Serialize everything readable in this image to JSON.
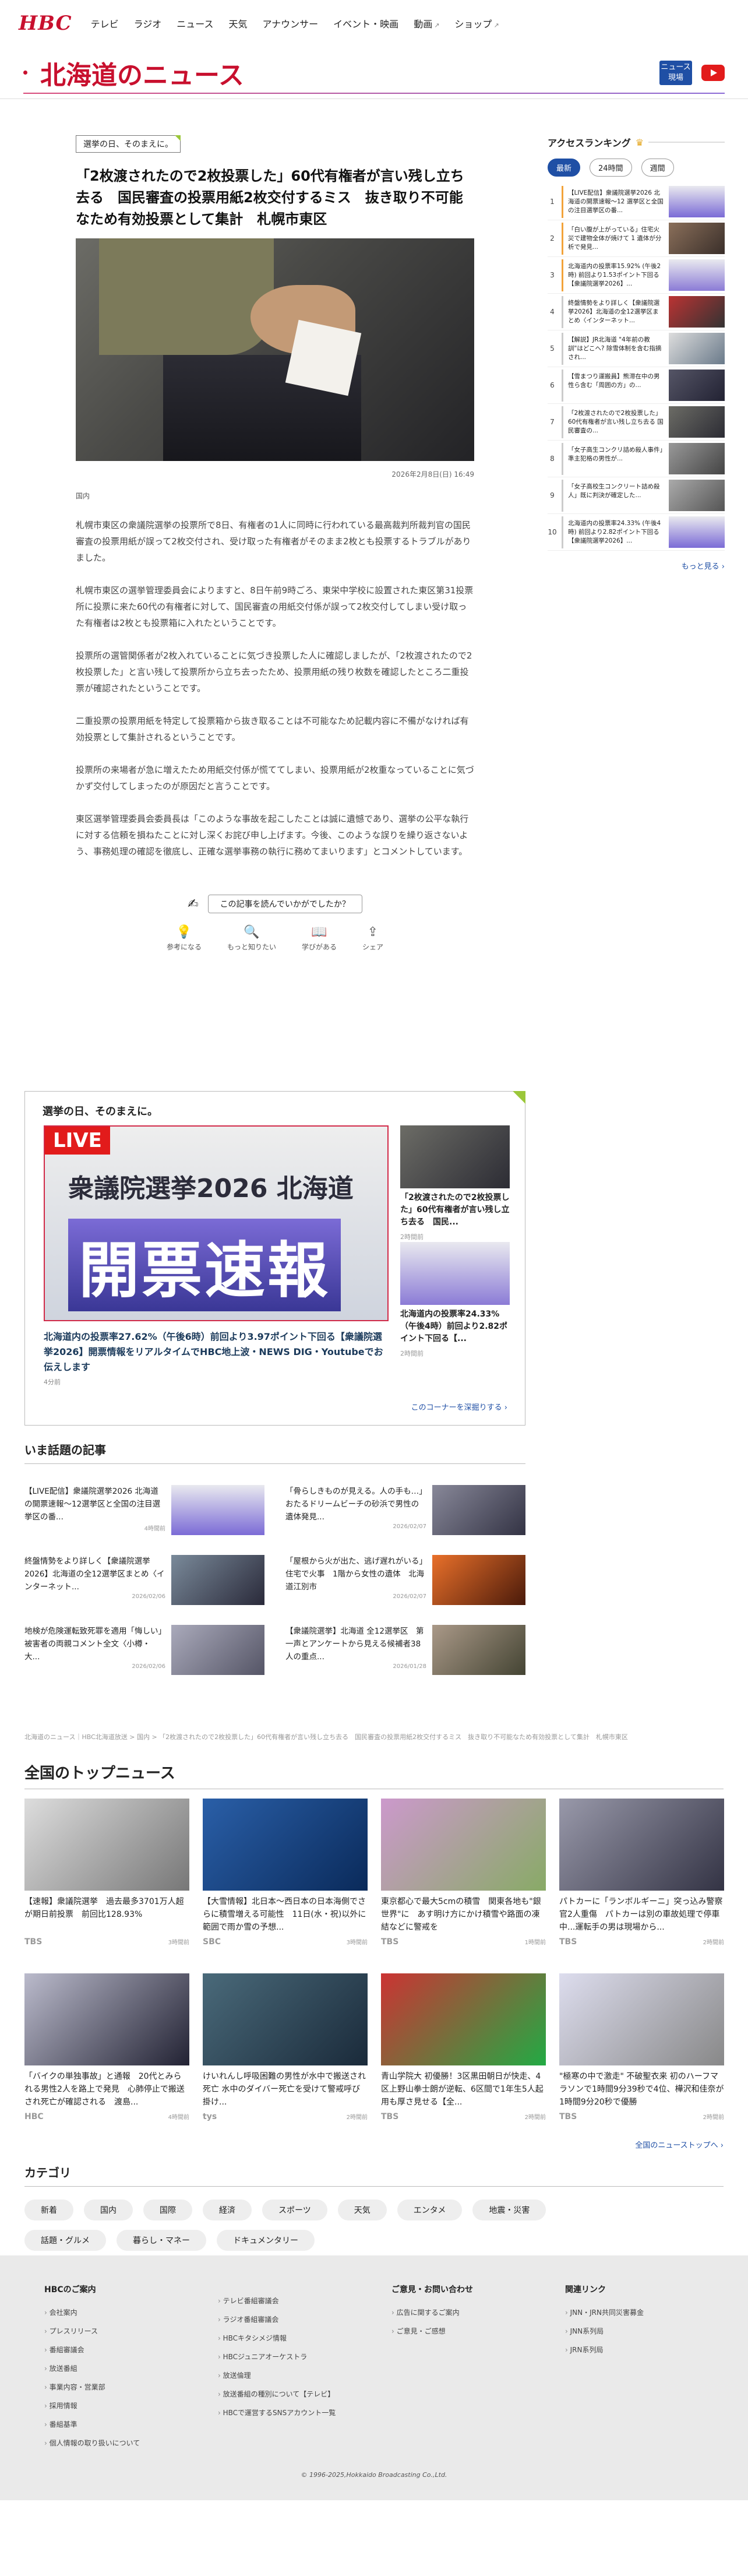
{
  "header": {
    "logo": "HBC",
    "nav": [
      "テレビ",
      "ラジオ",
      "ニュース",
      "天気",
      "アナウンサー",
      "イベント・映画",
      "動画",
      "ショップ"
    ],
    "page_title": "北海道のニュース",
    "newsnav_label": "ニュース 現場"
  },
  "article": {
    "tag": "選挙の日、そのまえに。",
    "headline": "「2枚渡されたので2枚投票した」60代有権者が言い残し立ち去る　国民審査の投票用紙2枚交付するミス　抜き取り不可能なため有効投票として集計　札幌市東区",
    "date": "2026年2月8日(日) 16:49",
    "category": "国内",
    "paragraphs": [
      "札幌市東区の衆議院選挙の投票所で8日、有権者の1人に同時に行われている最高裁判所裁判官の国民審査の投票用紙が誤って2枚交付され、受け取った有権者がそのまま2枚とも投票するトラブルがありました。",
      "札幌市東区の選挙管理委員会によりますと、8日午前9時ごろ、東栄中学校に設置された東区第31投票所に投票に来た60代の有権者に対して、国民審査の用紙交付係が誤って2枚交付してしまい受け取った有権者は2枚とも投票箱に入れたということです。",
      "投票所の選管関係者が2枚入れていることに気づき投票した人に確認しましたが、「2枚渡されたので2枚投票した」と言い残して投票所から立ち去ったため、投票用紙の残り枚数を確認したところ二重投票が確認されたということです。",
      "二重投票の投票用紙を特定して投票箱から抜き取ることは不可能なため記載内容に不備がなければ有効投票として集計されるということです。",
      "投票所の来場者が急に増えたため用紙交付係が慌ててしまい、投票用紙が2枚重なっていることに気づかず交付してしまったのが原因だと言うことです。",
      "東区選挙管理委員会委員長は「このような事故を起こしたことは誠に遺憾であり、選挙の公平な執行に対する信頼を損ねたことに対し深くお詫び申し上げます。今後、このような誤りを繰り返さないよう、事務処理の確認を徹底し、正確な選挙事務の執行に務めてまいります」とコメントしています。"
    ],
    "feedback_question": "この記事を読んでいかがでしたか？",
    "feedback_options": [
      "参考になる",
      "もっと知りたい",
      "学びがある",
      "シェア"
    ]
  },
  "ranking": {
    "title": "アクセスランキング",
    "tabs": [
      "最新",
      "24時間",
      "週間"
    ],
    "items": [
      {
        "rank": "1",
        "text": "【LIVE配信】衆議院選挙2026 北海道の開票速報〜12 選挙区と全国の注目選挙区の番..."
      },
      {
        "rank": "2",
        "text": "「白い腹が上がっている」住宅火災で建物全体が焼けて 1 遺体が分析で発見..."
      },
      {
        "rank": "3",
        "text": "北海道内の投票率15.92% (午後2時) 前回より1.53ポイント下回る【衆議院選挙2026】..."
      },
      {
        "rank": "4",
        "text": "終盤情勢をより詳しく【衆議院選挙2026】北海道の全12選挙区まとめ〈インターネット..."
      },
      {
        "rank": "5",
        "text": "【解説】JR北海道 \"4年前の教訓\"はどこへ? 除雪体制を含む指摘され..."
      },
      {
        "rank": "6",
        "text": "【雪まつり運搬員】熊滞在中の男性ら含む「周囲の方」の..."
      },
      {
        "rank": "7",
        "text": "「2枚渡されたので2枚投票した」60代有権者が言い残し立ち去る 国民審査の..."
      },
      {
        "rank": "8",
        "text": "「女子高生コンクリ詰め殺人事件」準主犯格の男性が..."
      },
      {
        "rank": "9",
        "text": "「女子高校生コンクリート詰め殺人」既に判決が確定した..."
      },
      {
        "rank": "10",
        "text": "北海道内の投票率24.33% (午後4時) 前回より2.82ポイント下回る【衆議院選挙2026】..."
      }
    ],
    "more": "もっと見る ›"
  },
  "series": {
    "title": "選挙の日、そのまえに。",
    "live": "LIVE",
    "banner_line1": "衆議院選挙2026 北海道",
    "banner_line2": "開票速報",
    "main_caption": "北海道内の投票率27.62%（午後6時）前回より3.97ポイント下回る【衆議院選挙2026】開票情報をリアルタイムでHBC地上波・NEWS DIG・Youtubeでお伝えします",
    "main_date": "4分前",
    "side": [
      {
        "caption": "「2枚渡されたので2枚投票した」60代有権者が言い残し立ち去る　国民...",
        "date": "2時間前"
      },
      {
        "caption": "北海道内の投票率24.33%（午後4時）前回より2.82ポイント下回る【...",
        "date": "2時間前"
      }
    ],
    "link": "このコーナーを深掘りする ›"
  },
  "trending": {
    "title": "いま話題の記事",
    "items": [
      {
        "text": "【LIVE配信】衆議院選挙2026 北海道の開票速報〜12選挙区と全国の注目選挙区の番...",
        "date": "4時間前"
      },
      {
        "text": "「骨らしきものが見える。人の手も…」おたるドリームビーチの砂浜で男性の遺体発見...",
        "date": "2026/02/07"
      },
      {
        "text": "終盤情勢をより詳しく【衆議院選挙2026】北海道の全12選挙区まとめ〈インターネット...",
        "date": "2026/02/06"
      },
      {
        "text": "「屋根から火が出た、逃げ遅れがいる」住宅で火事　1階から女性の遺体　北海道江別市",
        "date": "2026/02/07"
      },
      {
        "text": "地検が危険運転致死罪を適用「悔しい」被害者の両親コメント全文〈小樽・大...",
        "date": "2026/02/06"
      },
      {
        "text": "【衆議院選挙】北海道 全12選挙区　第一声とアンケートから見える候補者38人の重点...",
        "date": "2026/01/28"
      }
    ]
  },
  "breadcrumb": "北海道のニュース｜HBC北海道放送 > 国内 > 「2枚渡されたので2枚投票した」60代有権者が言い残し立ち去る　国民審査の投票用紙2枚交付するミス　抜き取り不可能なため有効投票として集計　札幌市東区",
  "topnews": {
    "title": "全国のトップニュース",
    "items": [
      {
        "text": "【速報】衆議院選挙　過去最多3701万人超が期日前投票　前回比128.93%",
        "station": "TBS",
        "date": "3時間前"
      },
      {
        "text": "【大雪情報】北日本〜西日本の日本海側でさらに積雪増える可能性　11日(水・祝)以外に範囲で雨か雪の予想...",
        "station": "SBC",
        "date": "3時間前"
      },
      {
        "text": "東京都心で最大5cmの積雪　関東各地も\"銀世界\"に　あす明け方にかけ積雪や路面の凍結などに警戒を",
        "station": "TBS",
        "date": "1時間前"
      },
      {
        "text": "パトカーに「ランボルギーニ」突っ込み警察官2人重傷　パトカーは別の車故処理で停車中...運転手の男は現場から...",
        "station": "TBS",
        "date": "2時間前"
      },
      {
        "text": "「バイクの単独事故」と通報　20代とみられる男性2人を路上で発見　心肺停止で搬送され死亡が確認される　渡島...",
        "station": "HBC",
        "date": "4時間前"
      },
      {
        "text": "けいれんし呼吸困難の男性が水中で搬送され死亡 水中のダイバー死亡を受けて警戒呼び掛け...",
        "station": "tys",
        "date": "2時間前"
      },
      {
        "text": "青山学院大 初優勝！3区黒田朝日が快走、4区上野山拳士朗が逆転、6区間で1年生5人起用も厚さ見せる【全...",
        "station": "TBS",
        "date": "2時間前"
      },
      {
        "text": "\"極寒の中で激走\" 不破聖衣来 初のハーフマラソンで1時間9分39秒で4位、樺沢和佳奈が1時間9分20秒で優勝",
        "station": "TBS",
        "date": "2時間前"
      }
    ],
    "more": "全国のニューストップへ ›"
  },
  "categories": {
    "title": "カテゴリ",
    "chips": [
      "新着",
      "国内",
      "国際",
      "経済",
      "スポーツ",
      "天気",
      "エンタメ",
      "地震・災害",
      "話題・グルメ",
      "暮らし・マネー",
      "ドキュメンタリー"
    ]
  },
  "footer": {
    "cols": [
      {
        "title": "HBCのご案内",
        "links": [
          "会社案内",
          "プレスリリース",
          "番組審議会",
          "放送番組",
          "事業内容・営業部",
          "採用情報",
          "番組基準",
          "個人情報の取り扱いについて"
        ]
      },
      {
        "title": "",
        "links": [
          "テレビ番組審議会",
          "ラジオ番組審議会",
          "HBCキタシメジ情報",
          "HBCジュニアオーケストラ",
          "放送倫理",
          "放送番組の種別について【テレビ】",
          "HBCで運営するSNSアカウント一覧"
        ]
      },
      {
        "title": "ご意見・お問い合わせ",
        "links": [
          "広告に関するご案内",
          "ご意見・ご感想"
        ]
      },
      {
        "title": "関連リンク",
        "links": [
          "JNN・JRN共同災害募金",
          "JNN系列局",
          "JRN系列局"
        ]
      }
    ],
    "copyright": "© 1996-2025,Hokkaido Broadcasting Co.,Ltd."
  }
}
